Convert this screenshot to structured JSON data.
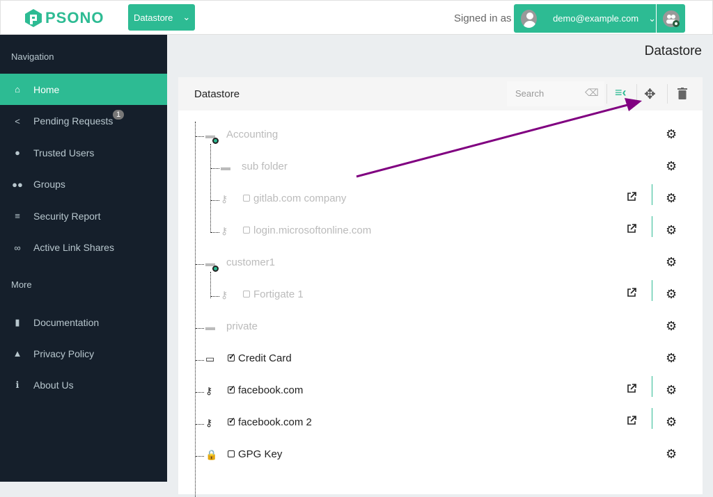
{
  "header": {
    "brand": "PSONO",
    "datastore_button": "Datastore",
    "signed_in_label": "Signed in as",
    "user": "demo@example.com"
  },
  "sidebar": {
    "nav_header": "Navigation",
    "more_header": "More",
    "items": [
      {
        "label": "Home",
        "icon": "home-icon",
        "active": true
      },
      {
        "label": "Pending Requests",
        "icon": "share-icon",
        "badge": "1"
      },
      {
        "label": "Trusted Users",
        "icon": "user-icon"
      },
      {
        "label": "Groups",
        "icon": "groups-icon"
      },
      {
        "label": "Security Report",
        "icon": "checklist-icon"
      },
      {
        "label": "Active Link Shares",
        "icon": "link-icon"
      }
    ],
    "more": [
      {
        "label": "Documentation",
        "icon": "book-icon"
      },
      {
        "label": "Privacy Policy",
        "icon": "user-secret-icon"
      },
      {
        "label": "About Us",
        "icon": "info-icon"
      }
    ]
  },
  "page": {
    "title": "Datastore"
  },
  "panel": {
    "title": "Datastore",
    "search_placeholder": "Search"
  },
  "tree": [
    {
      "label": "Accounting",
      "type": "shared-folder",
      "level": 0,
      "dim": true
    },
    {
      "label": "sub folder",
      "type": "folder",
      "level": 1,
      "dim": true
    },
    {
      "label": "gitlab.com company",
      "type": "key",
      "level": 1,
      "dim": true,
      "checkbox": false,
      "link": true
    },
    {
      "label": "login.microsoftonline.com",
      "type": "key",
      "level": 1,
      "dim": true,
      "checkbox": false,
      "link": true
    },
    {
      "label": "customer1",
      "type": "shared-folder",
      "level": 0,
      "dim": true
    },
    {
      "label": "Fortigate 1",
      "type": "key",
      "level": 1,
      "dim": true,
      "checkbox": false,
      "link": true
    },
    {
      "label": "private",
      "type": "folder",
      "level": 0,
      "dim": true
    },
    {
      "label": "Credit Card",
      "type": "card",
      "level": 0,
      "checkbox": true
    },
    {
      "label": "facebook.com",
      "type": "key",
      "level": 0,
      "checkbox": true,
      "link": true
    },
    {
      "label": "facebook.com 2",
      "type": "key",
      "level": 0,
      "checkbox": true,
      "link": true
    },
    {
      "label": "GPG Key",
      "type": "lock",
      "level": 0,
      "checkbox": false
    }
  ],
  "colors": {
    "accent": "#2dbb93",
    "sidebar": "#151f2b",
    "annotation_arrow": "#800080"
  }
}
